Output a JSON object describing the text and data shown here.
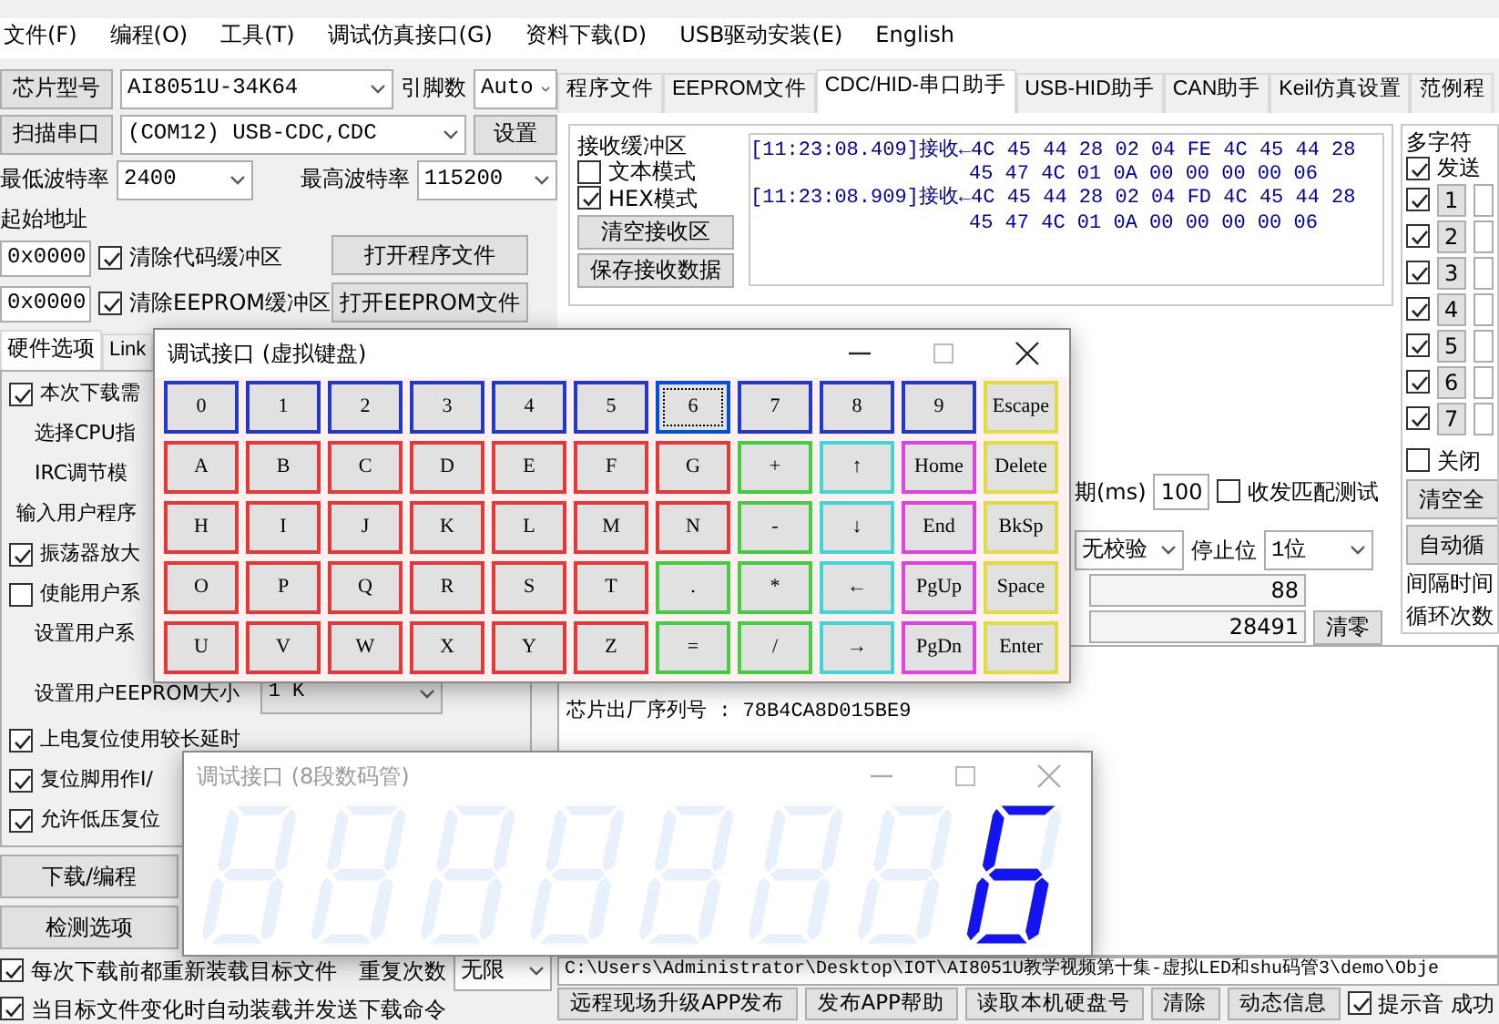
{
  "menu": [
    "文件(F)",
    "编程(O)",
    "工具(T)",
    "调试仿真接口(G)",
    "资料下载(D)",
    "USB驱动安装(E)",
    "English"
  ],
  "chip": {
    "button": "芯片型号",
    "value": "AI8051U-34K64",
    "pins_label": "引脚数",
    "pins_value": "Auto"
  },
  "port": {
    "button": "扫描串口",
    "value": "(COM12) USB-CDC,CDC",
    "settings_button": "设置"
  },
  "baud": {
    "min_label": "最低波特率",
    "min_value": "2400",
    "max_label": "最高波特率",
    "max_value": "115200"
  },
  "start_address": {
    "label": "起始地址",
    "code_value": "0x0000",
    "eeprom_value": "0x0000"
  },
  "clear_options": [
    {
      "label": "清除代码缓冲区",
      "checked": true
    },
    {
      "label": "清除EEPROM缓冲区",
      "checked": true
    }
  ],
  "open_buttons": [
    "打开程序文件",
    "打开EEPROM文件"
  ],
  "left_tabs": [
    {
      "label": "硬件选项",
      "selected": true
    },
    {
      "label": "Link",
      "selected": false
    }
  ],
  "hardware_options": [
    {
      "kind": "check",
      "label": "本次下载需",
      "checked": true
    },
    {
      "kind": "sub",
      "label": "选择CPU指"
    },
    {
      "kind": "sub",
      "label": "IRC调节模"
    },
    {
      "kind": "field",
      "label": "输入用户程序"
    },
    {
      "kind": "check",
      "label": "振荡器放大",
      "checked": true
    },
    {
      "kind": "check",
      "label": "使能用户系",
      "checked": false
    },
    {
      "kind": "sub",
      "label": "设置用户系"
    },
    {
      "kind": "select",
      "label": "设置用户EEPROM大小",
      "value": "1  K"
    },
    {
      "kind": "check",
      "label": "上电复位使用较长延时",
      "checked": true
    },
    {
      "kind": "check",
      "label": "复位脚用作I/",
      "checked": true
    },
    {
      "kind": "check",
      "label": "允许低压复位",
      "checked": true
    }
  ],
  "action_buttons": [
    "下载/编程",
    "检测选项"
  ],
  "reload_option": {
    "label": "每次下载前都重新装载目标文件",
    "checked": true
  },
  "repeat": {
    "label": "重复次数",
    "value": "无限"
  },
  "auto_option": {
    "label": "当目标文件变化时自动装载并发送下载命令",
    "checked": true
  },
  "tabs": [
    {
      "label": "程序文件",
      "selected": false
    },
    {
      "label": "EEPROM文件",
      "selected": false
    },
    {
      "label": "CDC/HID-串口助手",
      "selected": true
    },
    {
      "label": "USB-HID助手",
      "selected": false
    },
    {
      "label": "CAN助手",
      "selected": false
    },
    {
      "label": "Keil仿真设置",
      "selected": false
    },
    {
      "label": "范例程",
      "selected": false
    }
  ],
  "receive": {
    "title": "接收缓冲区",
    "modes": [
      {
        "label": "文本模式",
        "checked": false
      },
      {
        "label": "HEX模式",
        "checked": true
      }
    ],
    "buttons": [
      "清空接收区",
      "保存接收数据"
    ],
    "log": [
      {
        "kind": "head",
        "prefix": "[11:23:08.409]接收←",
        "bytes": "4C 45 44 28 02 04 FE 4C 45 44 28"
      },
      {
        "kind": "cont",
        "bytes": "45 47 4C 01 0A 00 00 00 00 06"
      },
      {
        "kind": "head",
        "prefix": "[11:23:08.909]接收←",
        "bytes": "4C 45 44 28 02 04 FD 4C 45 44 28"
      },
      {
        "kind": "cont",
        "bytes": "45 47 4C 01 0A 00 00 00 00 06"
      }
    ]
  },
  "send": {
    "period_label": "期(ms)",
    "period_value": "100",
    "match_test": {
      "label": "收发匹配测试",
      "checked": false
    },
    "parity_value": "无校验",
    "stop_label": "停止位",
    "stop_value": "1位",
    "sent_count": "88",
    "recv_count": "28491",
    "reset_button": "清零"
  },
  "multi": {
    "title": "多字符",
    "send": {
      "label": "发送",
      "checked": true
    },
    "rows": [
      {
        "label": "1",
        "checked": true
      },
      {
        "label": "2",
        "checked": true
      },
      {
        "label": "3",
        "checked": true
      },
      {
        "label": "4",
        "checked": true
      },
      {
        "label": "5",
        "checked": true
      },
      {
        "label": "6",
        "checked": true
      },
      {
        "label": "7",
        "checked": true
      }
    ],
    "close_tip": {
      "label": "关闭",
      "checked": false
    },
    "buttons": [
      "清空全",
      "自动循"
    ],
    "labels": [
      "间隔时间",
      "循环次数"
    ]
  },
  "info": [
    "芯片出厂序列号 : 78B4CA8D015BE9"
  ],
  "path": "C:\\Users\\Administrator\\Desktop\\IOT\\AI8051U教学视频第十集-虚拟LED和shu码管3\\demo\\Obje",
  "bottom_buttons": [
    "远程现场升级APP发布",
    "发布APP帮助",
    "读取本机硬盘号",
    "清除",
    "动态信息"
  ],
  "sound": {
    "label": "提示音",
    "checked": true
  },
  "status": "成功",
  "keyboard": {
    "title": "调试接口 (虚拟键盘)",
    "active": true,
    "rows": [
      [
        {
          "label": "0",
          "kind": "digit",
          "selected": false
        },
        {
          "label": "1",
          "kind": "digit",
          "selected": false
        },
        {
          "label": "2",
          "kind": "digit",
          "selected": false
        },
        {
          "label": "3",
          "kind": "digit",
          "selected": false
        },
        {
          "label": "4",
          "kind": "digit",
          "selected": false
        },
        {
          "label": "5",
          "kind": "digit",
          "selected": false
        },
        {
          "label": "6",
          "kind": "digit",
          "selected": true
        },
        {
          "label": "7",
          "kind": "digit",
          "selected": false
        },
        {
          "label": "8",
          "kind": "digit",
          "selected": false
        },
        {
          "label": "9",
          "kind": "digit",
          "selected": false
        },
        {
          "label": "Escape",
          "kind": "control",
          "selected": false
        }
      ],
      [
        {
          "label": "A",
          "kind": "letter",
          "selected": false
        },
        {
          "label": "B",
          "kind": "letter",
          "selected": false
        },
        {
          "label": "C",
          "kind": "letter",
          "selected": false
        },
        {
          "label": "D",
          "kind": "letter",
          "selected": false
        },
        {
          "label": "E",
          "kind": "letter",
          "selected": false
        },
        {
          "label": "F",
          "kind": "letter",
          "selected": false
        },
        {
          "label": "G",
          "kind": "letter",
          "selected": false
        },
        {
          "label": "+",
          "kind": "operator",
          "selected": false
        },
        {
          "label": "↑",
          "kind": "arrow",
          "selected": false
        },
        {
          "label": "Home",
          "kind": "navigation",
          "selected": false
        },
        {
          "label": "Delete",
          "kind": "control",
          "selected": false
        }
      ],
      [
        {
          "label": "H",
          "kind": "letter",
          "selected": false
        },
        {
          "label": "I",
          "kind": "letter",
          "selected": false
        },
        {
          "label": "J",
          "kind": "letter",
          "selected": false
        },
        {
          "label": "K",
          "kind": "letter",
          "selected": false
        },
        {
          "label": "L",
          "kind": "letter",
          "selected": false
        },
        {
          "label": "M",
          "kind": "letter",
          "selected": false
        },
        {
          "label": "N",
          "kind": "letter",
          "selected": false
        },
        {
          "label": "-",
          "kind": "operator",
          "selected": false
        },
        {
          "label": "↓",
          "kind": "arrow",
          "selected": false
        },
        {
          "label": "End",
          "kind": "navigation",
          "selected": false
        },
        {
          "label": "BkSp",
          "kind": "control",
          "selected": false
        }
      ],
      [
        {
          "label": "O",
          "kind": "letter",
          "selected": false
        },
        {
          "label": "P",
          "kind": "letter",
          "selected": false
        },
        {
          "label": "Q",
          "kind": "letter",
          "selected": false
        },
        {
          "label": "R",
          "kind": "letter",
          "selected": false
        },
        {
          "label": "S",
          "kind": "letter",
          "selected": false
        },
        {
          "label": "T",
          "kind": "letter",
          "selected": false
        },
        {
          "label": ".",
          "kind": "operator",
          "selected": false
        },
        {
          "label": "*",
          "kind": "operator",
          "selected": false
        },
        {
          "label": "←",
          "kind": "arrow",
          "selected": false
        },
        {
          "label": "PgUp",
          "kind": "navigation",
          "selected": false
        },
        {
          "label": "Space",
          "kind": "control",
          "selected": false
        }
      ],
      [
        {
          "label": "U",
          "kind": "letter",
          "selected": false
        },
        {
          "label": "V",
          "kind": "letter",
          "selected": false
        },
        {
          "label": "W",
          "kind": "letter",
          "selected": false
        },
        {
          "label": "X",
          "kind": "letter",
          "selected": false
        },
        {
          "label": "Y",
          "kind": "letter",
          "selected": false
        },
        {
          "label": "Z",
          "kind": "letter",
          "selected": false
        },
        {
          "label": "=",
          "kind": "operator",
          "selected": false
        },
        {
          "label": "/",
          "kind": "operator",
          "selected": false
        },
        {
          "label": "→",
          "kind": "arrow",
          "selected": false
        },
        {
          "label": "PgDn",
          "kind": "navigation",
          "selected": false
        },
        {
          "label": "Enter",
          "kind": "control",
          "selected": false
        }
      ]
    ]
  },
  "led": {
    "title": "调试接口 (8段数码管)",
    "active": false,
    "digits": [
      {
        "segments": [
          false,
          false,
          false,
          false,
          false,
          false,
          false
        ]
      },
      {
        "segments": [
          false,
          false,
          false,
          false,
          false,
          false,
          false
        ]
      },
      {
        "segments": [
          false,
          false,
          false,
          false,
          false,
          false,
          false
        ]
      },
      {
        "segments": [
          false,
          false,
          false,
          false,
          false,
          false,
          false
        ]
      },
      {
        "segments": [
          false,
          false,
          false,
          false,
          false,
          false,
          false
        ]
      },
      {
        "segments": [
          false,
          false,
          false,
          false,
          false,
          false,
          false
        ]
      },
      {
        "segments": [
          false,
          false,
          false,
          false,
          false,
          false,
          false
        ]
      },
      {
        "segments": [
          true,
          false,
          true,
          true,
          true,
          true,
          true
        ]
      }
    ]
  }
}
